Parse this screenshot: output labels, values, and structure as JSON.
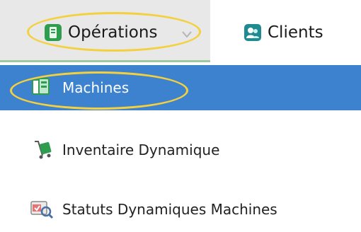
{
  "tabs": [
    {
      "label": "Opérations",
      "icon": "operations-icon",
      "selected": true,
      "has_dropdown": true
    },
    {
      "label": "Clients",
      "icon": "clients-icon",
      "selected": false
    }
  ],
  "menu": {
    "items": [
      {
        "label": "Machines",
        "icon": "machines-icon",
        "selected": true
      },
      {
        "label": "Inventaire Dynamique",
        "icon": "inventory-icon",
        "selected": false
      },
      {
        "label": "Statuts Dynamiques Machines",
        "icon": "status-icon",
        "selected": false
      }
    ]
  },
  "colors": {
    "selected_bg": "#3c82cf",
    "highlight": "#f4d03f",
    "tab_bg": "#e8e8e8",
    "icon_green": "#2e9d4f",
    "icon_teal": "#1f8a90"
  }
}
